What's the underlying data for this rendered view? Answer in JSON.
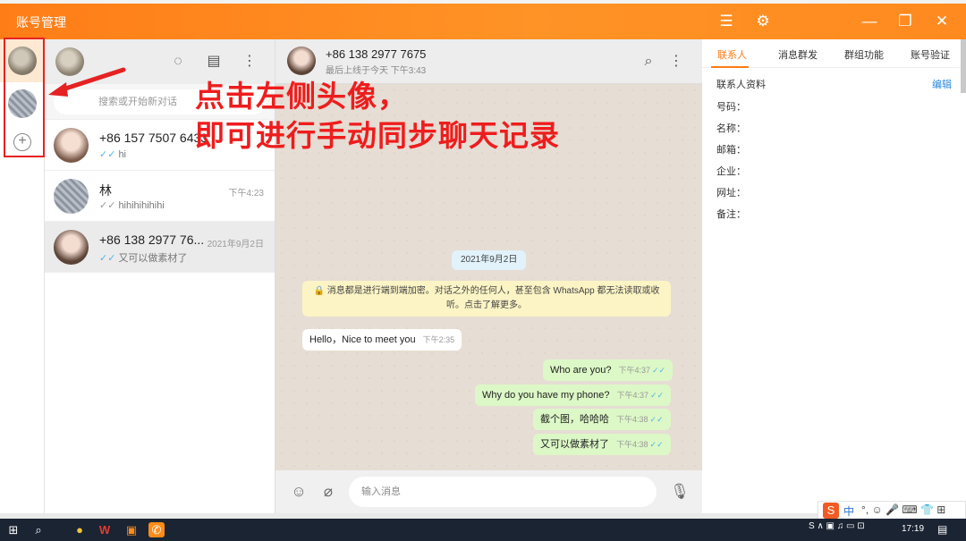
{
  "window": {
    "title": "账号管理"
  },
  "titlebar_icons": [
    "menu-icon",
    "gear-icon",
    "minimize-icon",
    "restore-icon",
    "close-icon"
  ],
  "accent_color": "#ff7d17",
  "annotation": {
    "line1": "点击左侧头像，",
    "line2": "即可进行手动同步聊天记录",
    "color": "#ee1d1d"
  },
  "sidebar": {
    "add_label": "+"
  },
  "chat_list": {
    "search_placeholder": "搜索或开始新对话",
    "items": [
      {
        "name": "+86 157 7507 6433",
        "time": "",
        "preview": "hi",
        "ticks": "✓✓"
      },
      {
        "name": "林",
        "time": "下午4:23",
        "preview": "hihihihihihi",
        "ticks": "✓✓"
      },
      {
        "name": "+86 138 2977 76...",
        "time": "2021年9月2日",
        "preview": "又可以做素材了",
        "ticks": "✓✓"
      }
    ]
  },
  "chat": {
    "contact_name": "+86 138 2977 7675",
    "status": "最后上线于今天 下午3:43",
    "date_label": "2021年9月2日",
    "encryption_line1": "🔒 消息都是进行端到端加密。对话之外的任何人，甚至包含 WhatsApp 都无法读取或收",
    "encryption_line2": "听。点击了解更多。",
    "messages": [
      {
        "text": "Hello，Nice to meet you",
        "time": "下午2:35",
        "dir": "in"
      },
      {
        "text": "Who are you?",
        "time": "下午4:37",
        "dir": "out"
      },
      {
        "text": "Why do you have my phone?",
        "time": "下午4:37",
        "dir": "out"
      },
      {
        "text": "截个图，哈哈哈",
        "time": "下午4:38",
        "dir": "out"
      },
      {
        "text": "又可以做素材了",
        "time": "下午4:38",
        "dir": "out"
      }
    ],
    "input_placeholder": "输入消息"
  },
  "info_panel": {
    "tabs": [
      "联系人",
      "消息群发",
      "群组功能",
      "账号验证"
    ],
    "selected_tab": "联系人",
    "section_title": "联系人资料",
    "edit_label": "编辑",
    "fields": [
      "号码：",
      "名称：",
      "邮箱：",
      "企业：",
      "网址：",
      "备注："
    ]
  },
  "taskbar": {
    "ime_label": "中",
    "time": "17:19"
  }
}
